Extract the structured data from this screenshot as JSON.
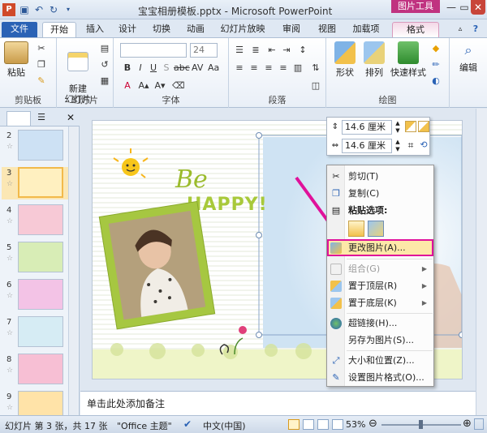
{
  "window": {
    "title": "宝宝相册模板.pptx - Microsoft PowerPoint",
    "context_tool": "图片工具"
  },
  "tabs": [
    "文件",
    "开始",
    "插入",
    "设计",
    "切换",
    "动画",
    "幻灯片放映",
    "审阅",
    "视图",
    "加载项",
    "格式"
  ],
  "ribbon": {
    "groups": [
      "剪贴板",
      "幻灯片",
      "字体",
      "段落",
      "绘图"
    ],
    "paste": "粘贴",
    "new_slide": "新建\n幻灯片",
    "shapes": "形状",
    "arrange": "排列",
    "quick_styles": "快速样式",
    "edit": "编辑",
    "font_size": "24"
  },
  "slides": [
    {
      "num": "2",
      "color": "#cde1f4"
    },
    {
      "num": "3",
      "color": "#fff0c0"
    },
    {
      "num": "4",
      "color": "#f7c9d6"
    },
    {
      "num": "5",
      "color": "#d8edb6"
    },
    {
      "num": "6",
      "color": "#f3c3e6"
    },
    {
      "num": "7",
      "color": "#d6ecf4"
    },
    {
      "num": "8",
      "color": "#f7bfd4"
    },
    {
      "num": "9",
      "color": "#ffe3a8"
    }
  ],
  "slide": {
    "be": "Be",
    "happy": "HAPPY!"
  },
  "size_toolbar": {
    "height": "14.6 厘米",
    "width": "14.6 厘米"
  },
  "context_menu": {
    "items": [
      {
        "label": "剪切(T)",
        "icon": "scissors-icon",
        "disabled": false
      },
      {
        "label": "复制(C)",
        "icon": "copy-icon",
        "disabled": false
      }
    ],
    "paste_options": "粘贴选项:",
    "items2": [
      {
        "label": "更改图片(A)...",
        "icon": "change-picture-icon",
        "disabled": false,
        "highlight": true
      },
      {
        "label": "组合(G)",
        "icon": "group-icon",
        "disabled": true,
        "arrow": true
      },
      {
        "label": "置于顶层(R)",
        "icon": "bring-front-icon",
        "disabled": false,
        "arrow": true
      },
      {
        "label": "置于底层(K)",
        "icon": "send-back-icon",
        "disabled": false,
        "arrow": true
      },
      {
        "label": "超链接(H)...",
        "icon": "hyperlink-icon",
        "disabled": false
      },
      {
        "label": "另存为图片(S)...",
        "icon": "save-picture-icon",
        "disabled": false
      },
      {
        "label": "大小和位置(Z)...",
        "icon": "size-position-icon",
        "disabled": false
      },
      {
        "label": "设置图片格式(O)...",
        "icon": "format-picture-icon",
        "disabled": false
      }
    ]
  },
  "notes": "单击此处添加备注",
  "status": {
    "slide_info": "幻灯片 第 3 张，共 17 张",
    "theme": "\"Office 主题\"",
    "language": "中文(中国)",
    "zoom": "53%"
  },
  "colors": {
    "highlight": "#e0119a",
    "accent": "#2a62b5"
  }
}
